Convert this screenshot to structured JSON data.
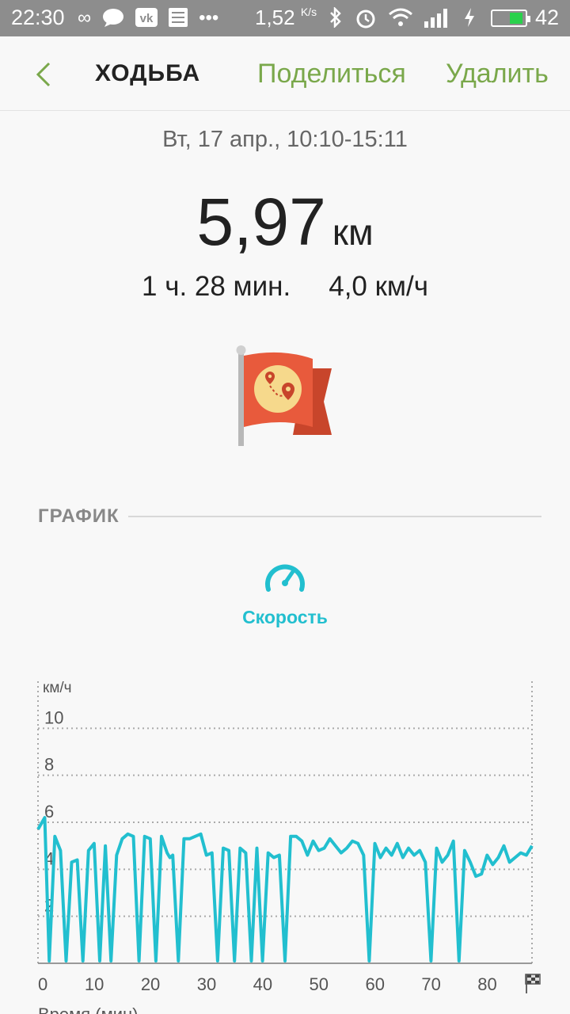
{
  "status_bar": {
    "time": "22:30",
    "net_speed": "1,52",
    "net_speed_unit": "K/s",
    "battery_level": "42",
    "icons": [
      "infinity-icon",
      "chat-bubble-icon",
      "vk-icon",
      "list-icon",
      "more-icon",
      "bluetooth-icon",
      "alarm-icon",
      "wifi-icon",
      "signal-icon",
      "charging-icon",
      "battery-icon"
    ]
  },
  "header": {
    "title": "ХОДЬБА",
    "share_label": "Поделиться",
    "delete_label": "Удалить"
  },
  "workout": {
    "date_range": "Вт, 17 апр., 10:10-15:11",
    "distance_value": "5,97",
    "distance_unit": "км",
    "duration": "1 ч. 28 мин.",
    "avg_speed": "4,0 км/ч"
  },
  "graph_section": {
    "label": "ГРАФИК",
    "metric_label": "Скорость",
    "x_axis_title": "Время (мин)"
  },
  "colors": {
    "accent_green": "#7aa84b",
    "chart_line": "#22bfcf",
    "flag_red": "#e85a3c"
  },
  "chart_data": {
    "type": "line",
    "ylabel": "км/ч",
    "yticks": [
      "10",
      "8",
      "6",
      "4",
      "2"
    ],
    "ylim": [
      0,
      12
    ],
    "xticks": [
      "0",
      "10",
      "20",
      "30",
      "40",
      "50",
      "60",
      "70",
      "80"
    ],
    "xlim": [
      0,
      88
    ],
    "grid": true,
    "series": [
      {
        "x": [
          0,
          1.2,
          2,
          3,
          4,
          5,
          6,
          7,
          8,
          9,
          10,
          11,
          12,
          13,
          14,
          15,
          16,
          17,
          18,
          19,
          20,
          21,
          22,
          23,
          23.5,
          24,
          25,
          26,
          27,
          28,
          29,
          30,
          31,
          32,
          33,
          34,
          35,
          36,
          37,
          38,
          39,
          40,
          41,
          42,
          43,
          44,
          45,
          46,
          47,
          48,
          49,
          50,
          51,
          52,
          53,
          54,
          55,
          56,
          57,
          58,
          59,
          60,
          61,
          62,
          63,
          64,
          65,
          66,
          67,
          68,
          69,
          70,
          71,
          72,
          73,
          74,
          75,
          76,
          77,
          78,
          79,
          80,
          81,
          82,
          83,
          84,
          85,
          86,
          87,
          88
        ],
        "values": [
          5.7,
          6.2,
          0.1,
          5.4,
          4.8,
          0.1,
          4.3,
          4.4,
          0.1,
          4.8,
          5.1,
          0.1,
          5.0,
          0.1,
          4.6,
          5.3,
          5.5,
          5.4,
          0.1,
          5.4,
          5.3,
          0.1,
          5.4,
          4.7,
          4.5,
          4.6,
          0.1,
          5.3,
          5.3,
          5.4,
          5.5,
          4.6,
          4.7,
          0.1,
          4.9,
          4.8,
          0.1,
          4.9,
          4.7,
          0.1,
          4.9,
          0.1,
          4.7,
          4.5,
          4.6,
          0.1,
          5.4,
          5.4,
          5.2,
          4.6,
          5.2,
          4.8,
          4.9,
          5.3,
          5.0,
          4.7,
          4.9,
          5.2,
          5.1,
          4.6,
          0.1,
          5.1,
          4.5,
          4.9,
          4.6,
          5.1,
          4.5,
          4.9,
          4.6,
          4.8,
          4.3,
          0.1,
          4.9,
          4.3,
          4.6,
          5.2,
          0.1,
          4.8,
          4.3,
          3.7,
          3.8,
          4.6,
          4.2,
          4.5,
          5.0,
          4.3,
          4.5,
          4.7,
          4.6,
          5.0
        ],
        "note": ""
      }
    ]
  }
}
